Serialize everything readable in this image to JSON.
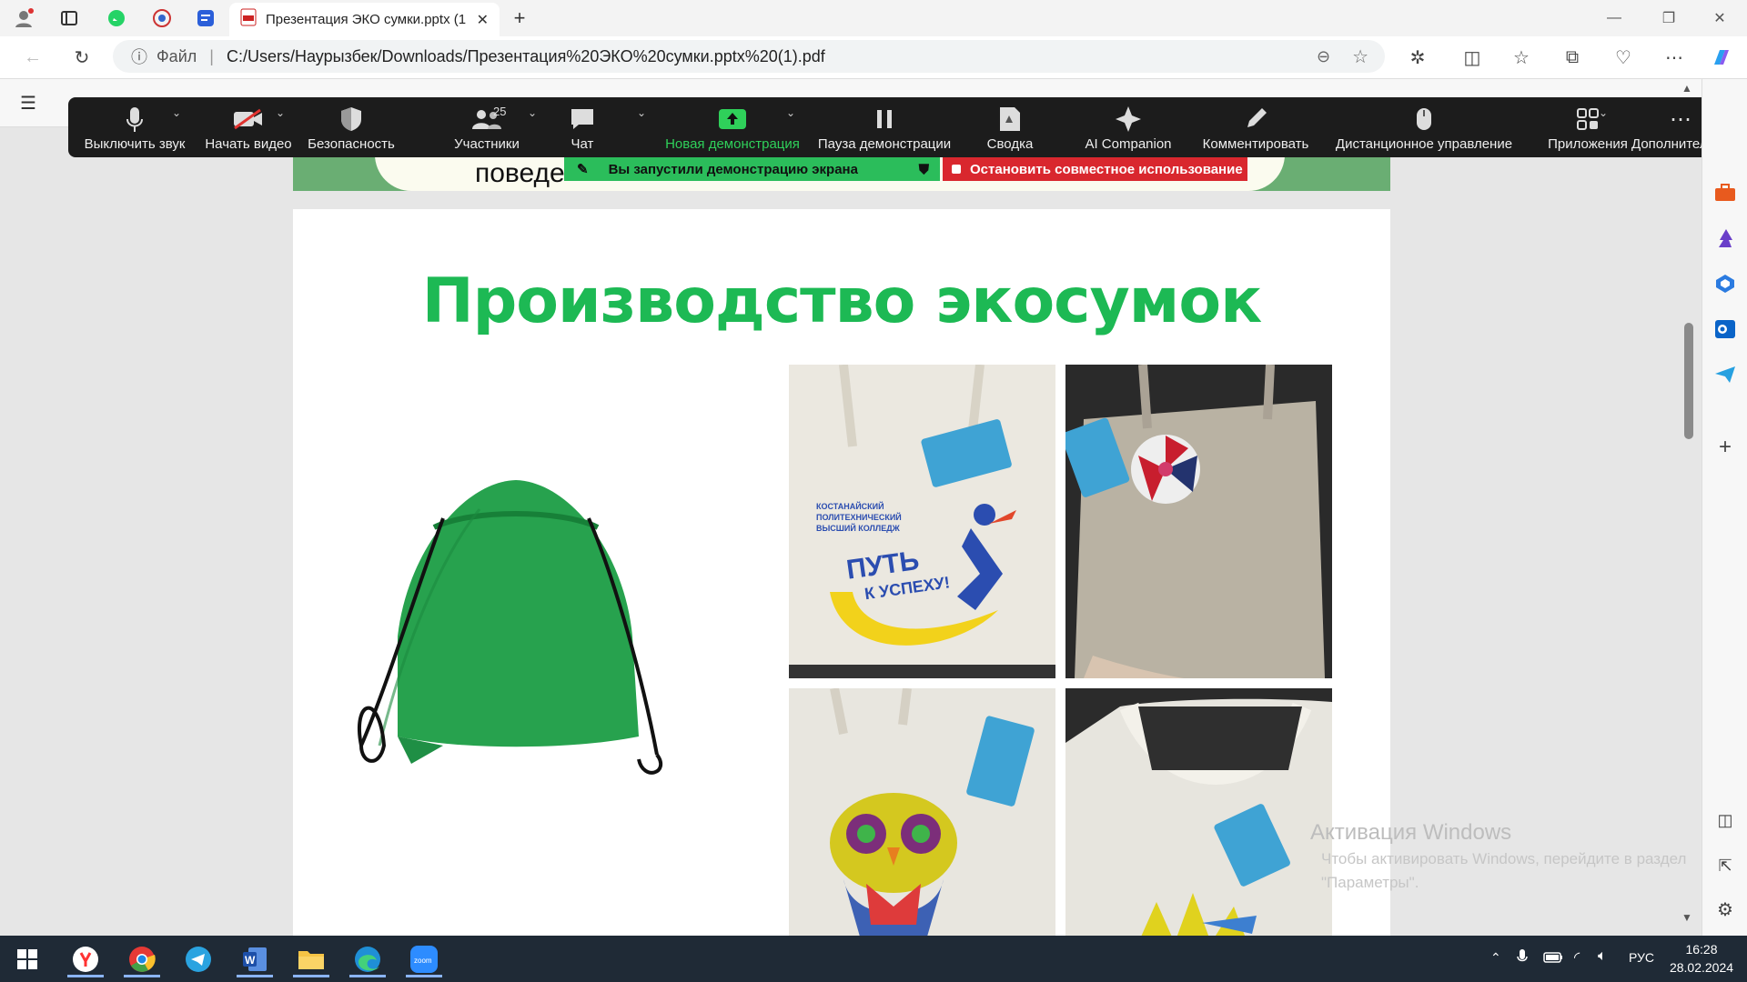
{
  "browser": {
    "tab_title": "Презентация ЭКО сумки.pptx (1",
    "file_label": "Файл",
    "url": "C:/Users/Наурызбек/Downloads/Презентация%20ЭКО%20сумки.pptx%20(1).pdf"
  },
  "zoom_toolbar": {
    "items": [
      {
        "label": "Выключить звук",
        "icon": "microphone-icon"
      },
      {
        "label": "Начать видео",
        "icon": "video-off-icon"
      },
      {
        "label": "Безопасность",
        "icon": "shield-icon"
      },
      {
        "label": "Участники",
        "icon": "participants-icon",
        "count": "25"
      },
      {
        "label": "Чат",
        "icon": "chat-icon"
      },
      {
        "label": "Новая демонстрация",
        "icon": "share-screen-icon"
      },
      {
        "label": "Пауза демонстрации",
        "icon": "pause-icon"
      },
      {
        "label": "Сводка",
        "icon": "summary-icon"
      },
      {
        "label": "AI Companion",
        "icon": "sparkle-icon"
      },
      {
        "label": "Комментировать",
        "icon": "pencil-icon"
      },
      {
        "label": "Дистанционное управление",
        "icon": "mouse-icon"
      },
      {
        "label": "Приложения",
        "icon": "apps-icon"
      },
      {
        "label": "Дополнительно",
        "icon": "more-icon"
      }
    ],
    "share_banner": "Вы запустили демонстрацию экрана",
    "stop_banner": "Остановить совместное использование"
  },
  "slide": {
    "prev_text_fragment": "поведе",
    "title": "Производство экосумок",
    "bag1_line1": "КОСТАНАЙСКИЙ",
    "bag1_line2": "ПОЛИТЕХНИЧЕСКИЙ",
    "bag1_line3": "ВЫСШИЙ КОЛЛЕДЖ",
    "bag1_slogan1": "ПУТЬ",
    "bag1_slogan2": "К УСПЕХУ!"
  },
  "watermark": {
    "line1": "Активация Windows",
    "line2": "Чтобы активировать Windows, перейдите в раздел",
    "line3": "\"Параметры\"."
  },
  "taskbar": {
    "lang": "РУС",
    "time": "16:28",
    "date": "28.02.2024"
  },
  "colors": {
    "zoom_green": "#2fd05a",
    "title_green": "#1db954",
    "stop_red": "#d9272e",
    "bag_green": "#27a24e"
  }
}
